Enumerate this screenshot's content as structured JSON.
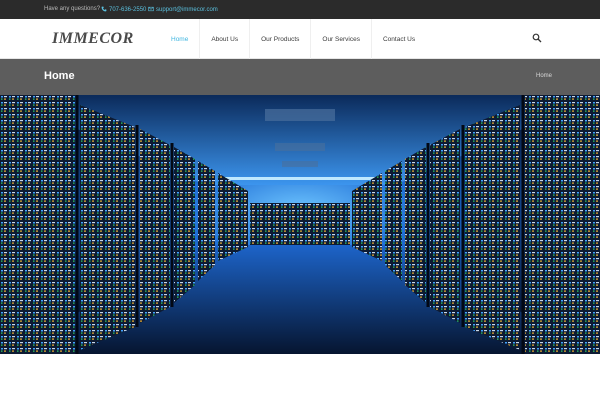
{
  "topbar": {
    "question": "Have any questions?",
    "phone": "707-636-2550",
    "email": "support@immecor.com",
    "phone_icon": "phone-icon",
    "email_icon": "envelope-icon"
  },
  "header": {
    "logo": "IMMECOR",
    "nav": [
      {
        "label": "Home",
        "active": true
      },
      {
        "label": "About Us",
        "active": false
      },
      {
        "label": "Our Products",
        "active": false
      },
      {
        "label": "Our Services",
        "active": false
      },
      {
        "label": "Contact Us",
        "active": false
      }
    ],
    "search_icon": "search-icon"
  },
  "page_title": {
    "title": "Home",
    "breadcrumb": "Home"
  },
  "hero": {
    "image_subject": "data center server racks corridor"
  },
  "colors": {
    "accent": "#3fb6e0",
    "topbar_bg": "#2b2b2b",
    "titlebar_bg": "#5d5d5d"
  }
}
